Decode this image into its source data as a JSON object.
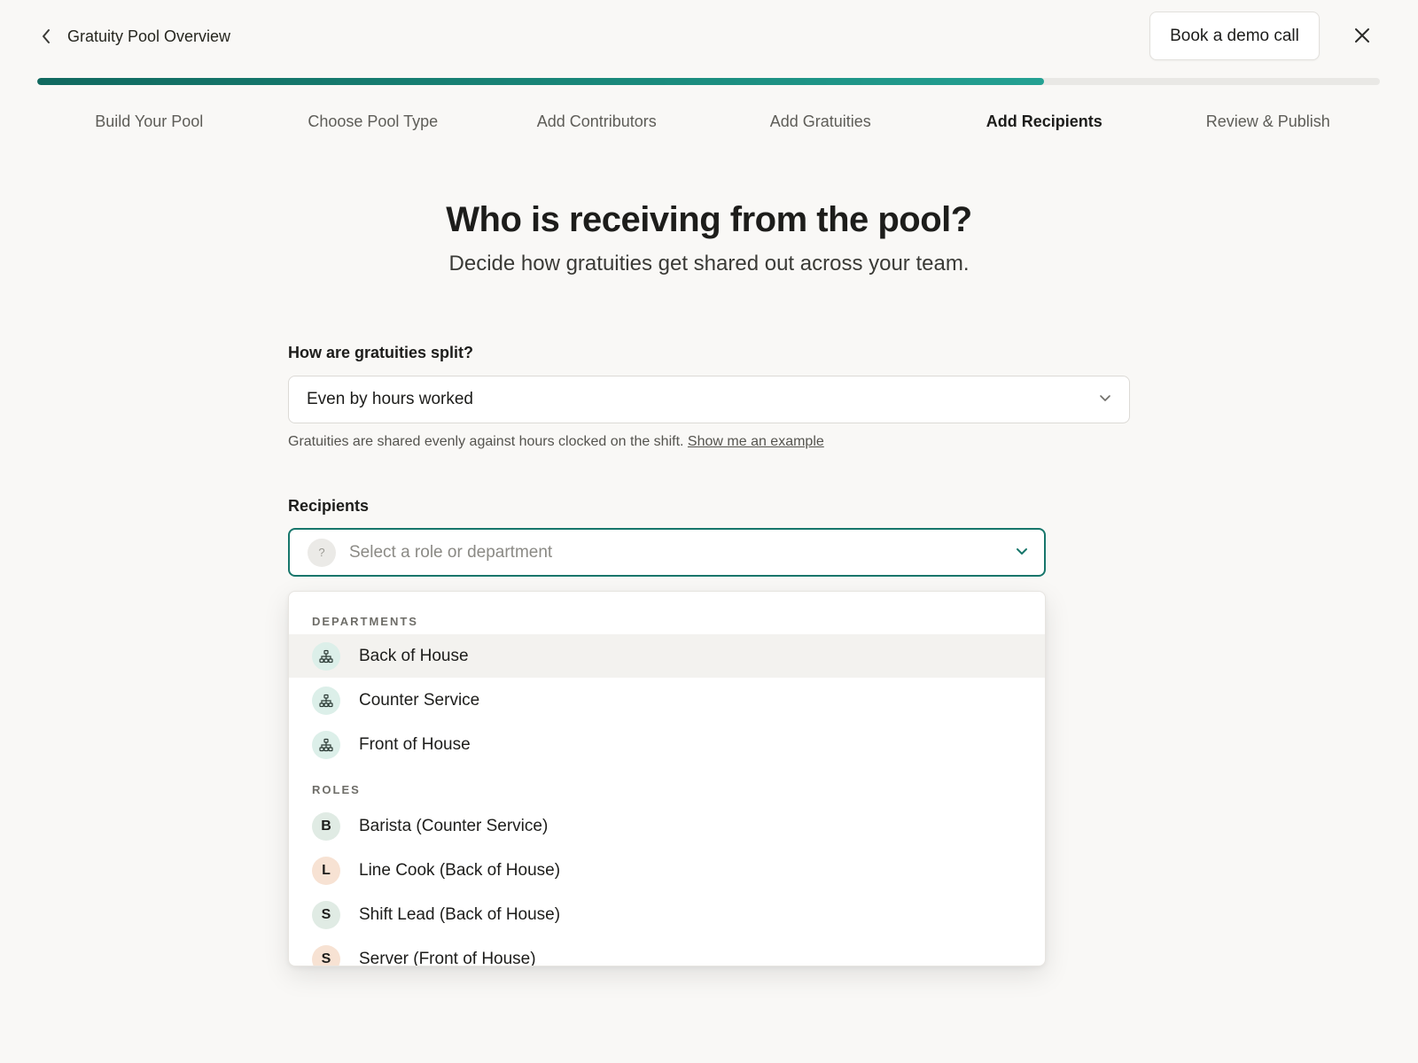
{
  "header": {
    "back_label": "Gratuity Pool Overview",
    "demo_button": "Book a demo call"
  },
  "progress": {
    "fraction": 0.75
  },
  "steps": [
    {
      "label": "Build Your Pool",
      "active": false
    },
    {
      "label": "Choose Pool Type",
      "active": false
    },
    {
      "label": "Add Contributors",
      "active": false
    },
    {
      "label": "Add Gratuities",
      "active": false
    },
    {
      "label": "Add Recipients",
      "active": true
    },
    {
      "label": "Review & Publish",
      "active": false
    }
  ],
  "hero": {
    "title": "Who is receiving from the pool?",
    "subtitle": "Decide how gratuities get shared out across your team."
  },
  "split": {
    "label": "How are gratuities split?",
    "value": "Even by hours worked",
    "helper": "Gratuities are shared evenly against hours clocked on the shift.",
    "helper_link": "Show me an example"
  },
  "recipients": {
    "label": "Recipients",
    "placeholder_icon": "?",
    "placeholder": "Select a role or department"
  },
  "dropdown": {
    "departments_label": "DEPARTMENTS",
    "departments": [
      {
        "label": "Back of House",
        "icon": "org-chart-icon",
        "highlighted": true
      },
      {
        "label": "Counter Service",
        "icon": "org-chart-icon",
        "highlighted": false
      },
      {
        "label": "Front of House",
        "icon": "org-chart-icon",
        "highlighted": false
      }
    ],
    "roles_label": "ROLES",
    "roles": [
      {
        "initial": "B",
        "label": "Barista (Counter Service)",
        "color": "#e0ebe4"
      },
      {
        "initial": "L",
        "label": "Line Cook (Back of House)",
        "color": "#f7e2d3"
      },
      {
        "initial": "S",
        "label": "Shift Lead (Back of House)",
        "color": "#e0ebe4"
      },
      {
        "initial": "S",
        "label": "Server (Front of House)",
        "color": "#f7e2d3"
      }
    ]
  },
  "colors": {
    "accent": "#17766b",
    "department_badge": "#dcefe9",
    "background": "#f9f8f6"
  }
}
